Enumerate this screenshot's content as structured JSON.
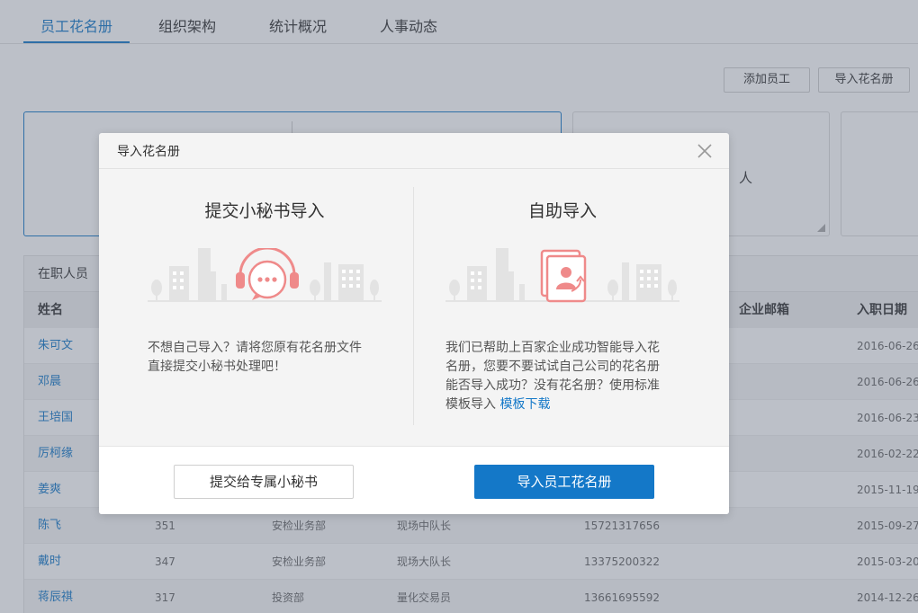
{
  "tabs": [
    {
      "label": "员工花名册",
      "active": true
    },
    {
      "label": "组织架构",
      "active": false
    },
    {
      "label": "统计概况",
      "active": false
    },
    {
      "label": "人事动态",
      "active": false
    }
  ],
  "toolbar": {
    "add_employee": "添加员工",
    "import_roster": "导入花名册"
  },
  "cards": {
    "middle_unit": "人"
  },
  "panel": {
    "title": "在职人员",
    "columns": {
      "name": "姓名",
      "email": "企业邮箱",
      "join_date": "入职日期"
    },
    "rows": [
      {
        "name": "朱可文",
        "id": "",
        "dept": "",
        "title": "",
        "phone": "",
        "date": "2016-06-26"
      },
      {
        "name": "邓晨",
        "id": "",
        "dept": "",
        "title": "",
        "phone": "",
        "date": "2016-06-26"
      },
      {
        "name": "王培国",
        "id": "",
        "dept": "",
        "title": "",
        "phone": "",
        "date": "2016-06-23"
      },
      {
        "name": "厉柯缘",
        "id": "",
        "dept": "",
        "title": "",
        "phone": "",
        "date": "2016-02-22"
      },
      {
        "name": "姜爽",
        "id": "",
        "dept": "",
        "title": "",
        "phone": "",
        "date": "2015-11-19"
      },
      {
        "name": "陈飞",
        "id": "351",
        "dept": "安检业务部",
        "title": "现场中队长",
        "phone": "15721317656",
        "date": "2015-09-27"
      },
      {
        "name": "戴时",
        "id": "347",
        "dept": "安检业务部",
        "title": "现场大队长",
        "phone": "13375200322",
        "date": "2015-03-20"
      },
      {
        "name": "蒋辰祺",
        "id": "317",
        "dept": "投资部",
        "title": "量化交易员",
        "phone": "13661695592",
        "date": "2014-12-26"
      }
    ]
  },
  "modal": {
    "title": "导入花名册",
    "left": {
      "title": "提交小秘书导入",
      "desc_line1": "不想自己导入？请将您原有花名册文件",
      "desc_line2": "直接提交小秘书处理吧！",
      "button": "提交给专属小秘书",
      "icon": "headset-chat-icon"
    },
    "right": {
      "title": "自助导入",
      "desc_line1": "我们已帮助上百家企业成功智能导入花",
      "desc_line2": "名册，您要不要试试自己公司的花名册",
      "desc_line3": "能否导入成功？没有花名册？使用标准",
      "desc_line4_prefix": "模板导入",
      "desc_link": "模板下载",
      "button": "导入员工花名册",
      "icon": "contact-import-icon"
    }
  },
  "colors": {
    "accent": "#1478c8",
    "illustration": "#ef8a8a",
    "overlay": "#586276"
  }
}
